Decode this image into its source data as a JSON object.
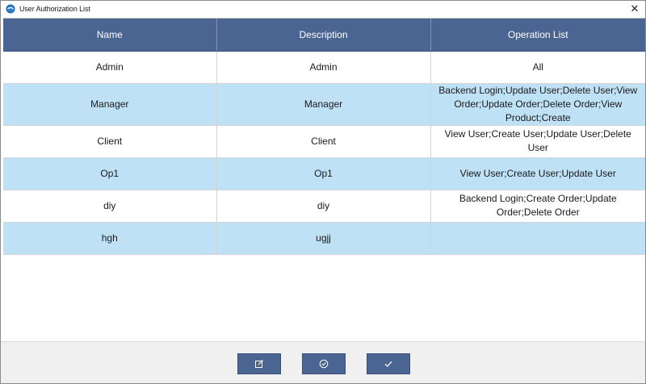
{
  "window": {
    "title": "User Authorization List",
    "close_glyph": "✕"
  },
  "grid": {
    "columns": [
      "Name",
      "Description",
      "Operation List"
    ],
    "rows": [
      {
        "name": "Admin",
        "description": "Admin",
        "operations": "All"
      },
      {
        "name": "Manager",
        "description": "Manager",
        "operations": "Backend Login;Update User;Delete User;View Order;Update Order;Delete Order;View Product;Create"
      },
      {
        "name": "Client",
        "description": "Client",
        "operations": "View User;Create User;Update User;Delete User"
      },
      {
        "name": "Op1",
        "description": "Op1",
        "operations": "View User;Create User;Update User"
      },
      {
        "name": "diy",
        "description": "diy",
        "operations": "Backend Login;Create Order;Update Order;Delete Order"
      },
      {
        "name": "hgh",
        "description": "ugjj",
        "operations": ""
      }
    ]
  },
  "footer": {
    "buttons": [
      {
        "icon": "edit-icon"
      },
      {
        "icon": "circle-check-icon"
      },
      {
        "icon": "check-icon"
      }
    ]
  },
  "colors": {
    "header_bg": "#4b6592",
    "alt_row_bg": "#bfe1f5",
    "button_bg": "#4b6592"
  }
}
